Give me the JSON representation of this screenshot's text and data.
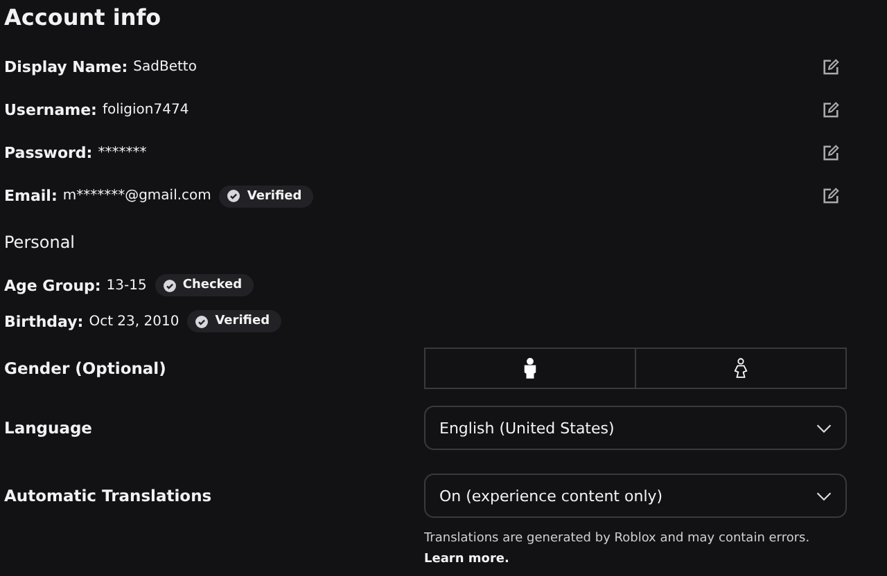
{
  "title": "Account info",
  "account_rows": [
    {
      "label": "Display Name:",
      "value": "SadBetto"
    },
    {
      "label": "Username:",
      "value": "foligion7474"
    },
    {
      "label": "Password:",
      "value": "*******"
    },
    {
      "label": "Email:",
      "value": "m*******@gmail.com",
      "badge": "Verified"
    }
  ],
  "personal_heading": "Personal",
  "personal_rows": [
    {
      "label": "Age Group:",
      "value": "13-15",
      "badge": "Checked"
    },
    {
      "label": "Birthday:",
      "value": "Oct 23, 2010",
      "badge": "Verified"
    }
  ],
  "gender": {
    "label": "Gender (Optional)",
    "options": [
      {
        "kind": "male",
        "selected": true
      },
      {
        "kind": "female",
        "selected": false
      }
    ]
  },
  "language": {
    "label": "Language",
    "value": "English (United States)"
  },
  "translations": {
    "label": "Automatic Translations",
    "value": "On (experience content only)",
    "note": "Translations are generated by Roblox and may contain errors.",
    "link": "Learn more."
  }
}
